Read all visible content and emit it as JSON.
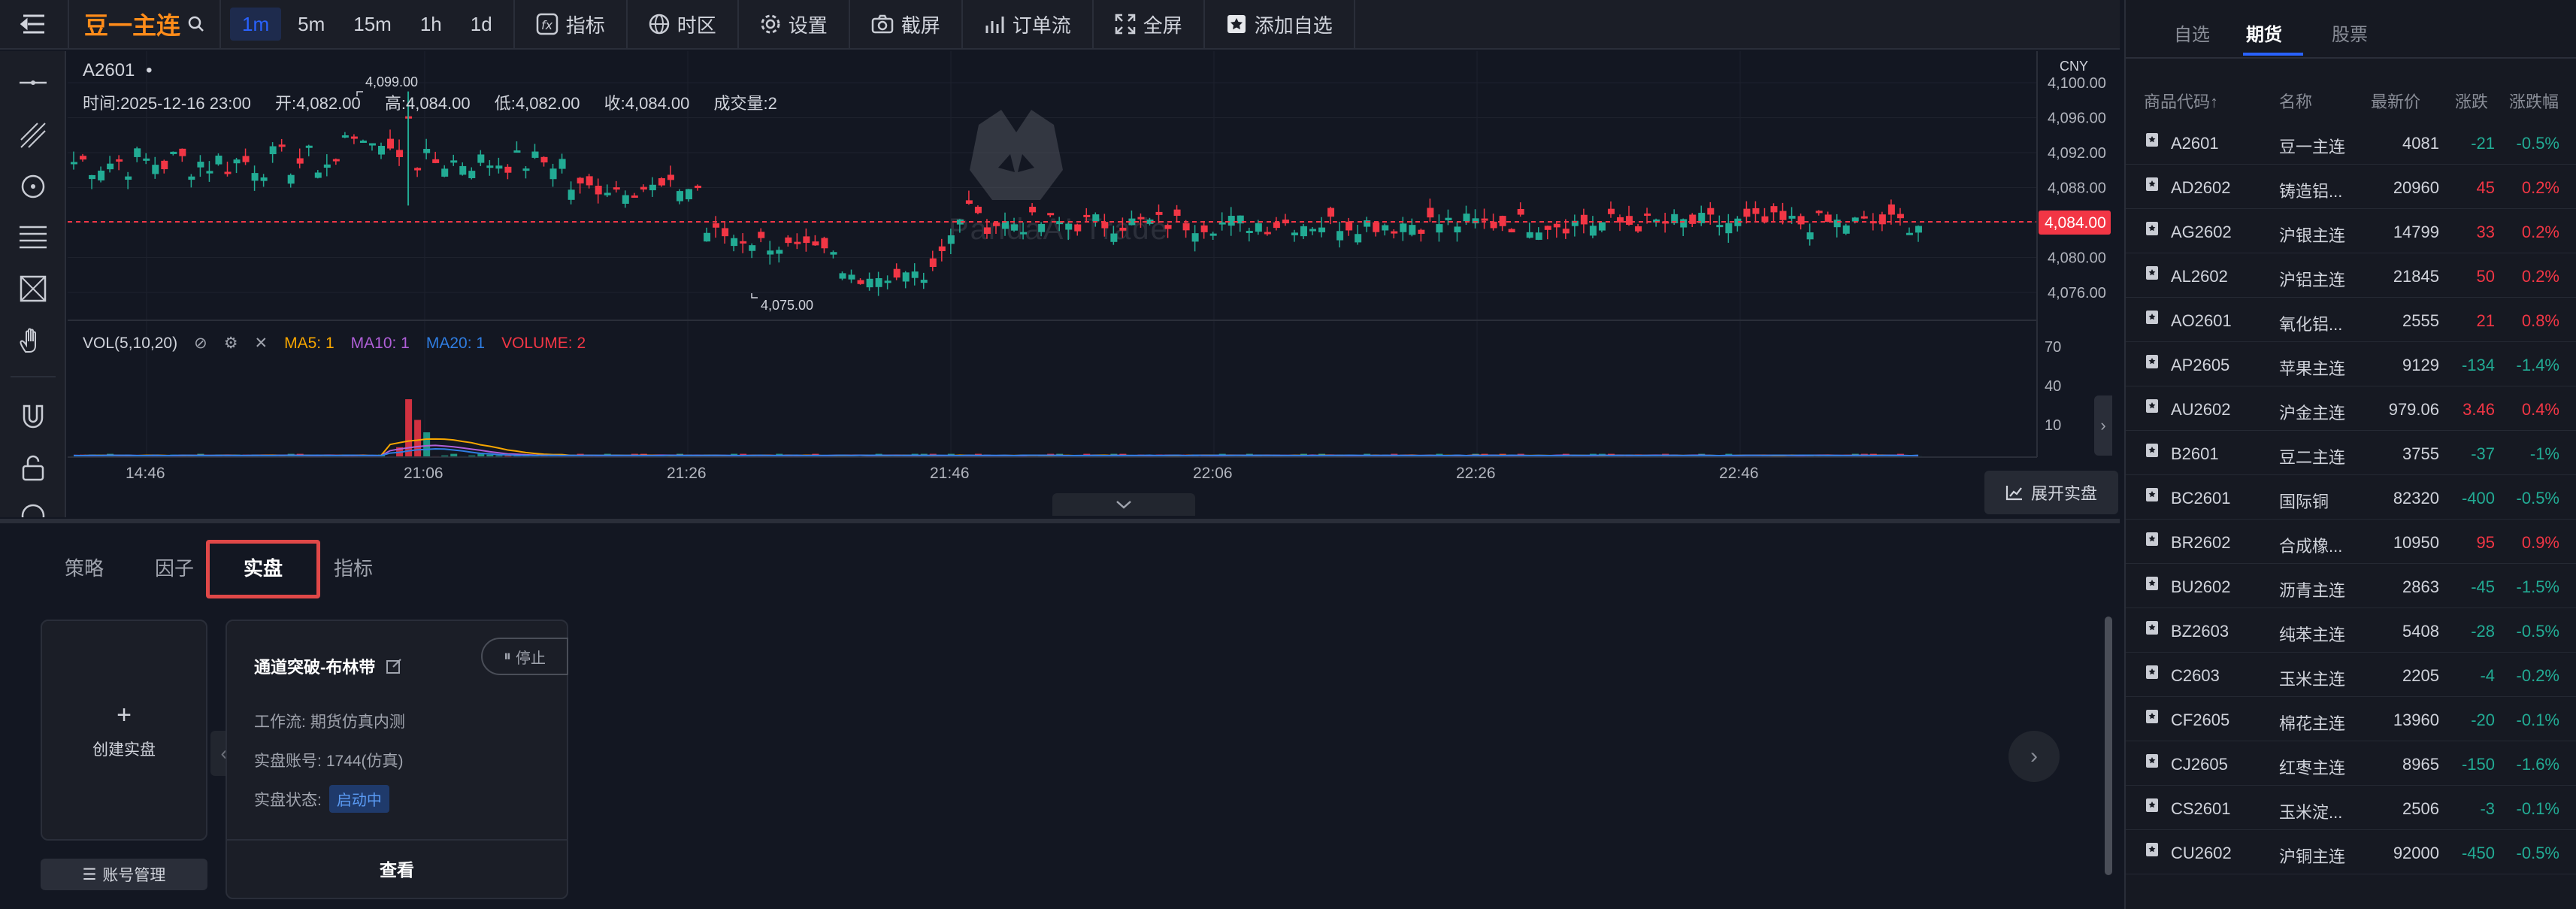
{
  "toolbar": {
    "title": "豆一主连",
    "timeframes": [
      "1m",
      "5m",
      "15m",
      "1h",
      "1d"
    ],
    "active_timeframe": "1m",
    "buttons": [
      "指标",
      "时区",
      "设置",
      "截屏",
      "订单流",
      "全屏",
      "添加自选"
    ]
  },
  "chart": {
    "symbol": "A2601",
    "currency": "CNY",
    "legend": {
      "time_label": "时间:",
      "time": "2025-12-16 23:00",
      "open_label": "开:",
      "open": "4,082.00",
      "high_label": "高:",
      "high": "4,084.00",
      "low_label": "低:",
      "low": "4,082.00",
      "close_label": "收:",
      "close": "4,084.00",
      "vol_label": "成交量:",
      "vol": "2"
    },
    "price_axis": [
      "4,100.00",
      "4,096.00",
      "4,092.00",
      "4,088.00",
      "4,084.00",
      "4,080.00",
      "4,076.00"
    ],
    "current_price": "4,084.00",
    "high_marker": "4,099.00",
    "low_marker": "4,075.00",
    "watermark": "PandaAI Trade",
    "vol": {
      "title": "VOL(5,10,20)",
      "ma5": "MA5: 1",
      "ma10": "MA10: 1",
      "ma20": "MA20: 1",
      "volume": "VOLUME: 2",
      "axis": [
        "70",
        "40",
        "10"
      ]
    },
    "time_axis": [
      "14:46",
      "21:06",
      "21:26",
      "21:46",
      "22:06",
      "22:26",
      "22:46"
    ],
    "expand_button": "展开实盘",
    "colors": {
      "up": "#f23645",
      "down": "#22ab94",
      "ma5": "#f7a600",
      "ma10": "#b05fd8",
      "ma20": "#2f7de1"
    }
  },
  "bottom": {
    "tabs": [
      "策略",
      "因子",
      "实盘",
      "指标"
    ],
    "active_tab": "实盘",
    "create_label": "创建实盘",
    "account_button": "账号管理",
    "card": {
      "title": "通道突破-布林带",
      "stop_button": "停止",
      "workflow_label": "工作流:",
      "workflow": "期货仿真内测",
      "account_label": "实盘账号:",
      "account": "1744(仿真)",
      "status_label": "实盘状态:",
      "status": "启动中",
      "view_button": "查看"
    }
  },
  "right": {
    "tabs": [
      "自选",
      "期货",
      "股票"
    ],
    "active_tab": "期货",
    "headers": [
      "商品代码↑",
      "名称",
      "最新价",
      "涨跌",
      "涨跌幅"
    ],
    "rows": [
      {
        "code": "A2601",
        "name": "豆一主连",
        "price": "4081",
        "chg": "-21",
        "pct": "-0.5%",
        "dir": "down"
      },
      {
        "code": "AD2602",
        "name": "铸造铝...",
        "price": "20960",
        "chg": "45",
        "pct": "0.2%",
        "dir": "up"
      },
      {
        "code": "AG2602",
        "name": "沪银主连",
        "price": "14799",
        "chg": "33",
        "pct": "0.2%",
        "dir": "up"
      },
      {
        "code": "AL2602",
        "name": "沪铝主连",
        "price": "21845",
        "chg": "50",
        "pct": "0.2%",
        "dir": "up"
      },
      {
        "code": "AO2601",
        "name": "氧化铝...",
        "price": "2555",
        "chg": "21",
        "pct": "0.8%",
        "dir": "up"
      },
      {
        "code": "AP2605",
        "name": "苹果主连",
        "price": "9129",
        "chg": "-134",
        "pct": "-1.4%",
        "dir": "down"
      },
      {
        "code": "AU2602",
        "name": "沪金主连",
        "price": "979.06",
        "chg": "3.46",
        "pct": "0.4%",
        "dir": "up"
      },
      {
        "code": "B2601",
        "name": "豆二主连",
        "price": "3755",
        "chg": "-37",
        "pct": "-1%",
        "dir": "down"
      },
      {
        "code": "BC2601",
        "name": "国际铜",
        "price": "82320",
        "chg": "-400",
        "pct": "-0.5%",
        "dir": "down"
      },
      {
        "code": "BR2602",
        "name": "合成橡...",
        "price": "10950",
        "chg": "95",
        "pct": "0.9%",
        "dir": "up"
      },
      {
        "code": "BU2602",
        "name": "沥青主连",
        "price": "2863",
        "chg": "-45",
        "pct": "-1.5%",
        "dir": "down"
      },
      {
        "code": "BZ2603",
        "name": "纯苯主连",
        "price": "5408",
        "chg": "-28",
        "pct": "-0.5%",
        "dir": "down"
      },
      {
        "code": "C2603",
        "name": "玉米主连",
        "price": "2205",
        "chg": "-4",
        "pct": "-0.2%",
        "dir": "down"
      },
      {
        "code": "CF2605",
        "name": "棉花主连",
        "price": "13960",
        "chg": "-20",
        "pct": "-0.1%",
        "dir": "down"
      },
      {
        "code": "CJ2605",
        "name": "红枣主连",
        "price": "8965",
        "chg": "-150",
        "pct": "-1.6%",
        "dir": "down"
      },
      {
        "code": "CS2601",
        "name": "玉米淀...",
        "price": "2506",
        "chg": "-3",
        "pct": "-0.1%",
        "dir": "down"
      },
      {
        "code": "CU2602",
        "name": "沪铜主连",
        "price": "92000",
        "chg": "-450",
        "pct": "-0.5%",
        "dir": "down"
      }
    ]
  }
}
